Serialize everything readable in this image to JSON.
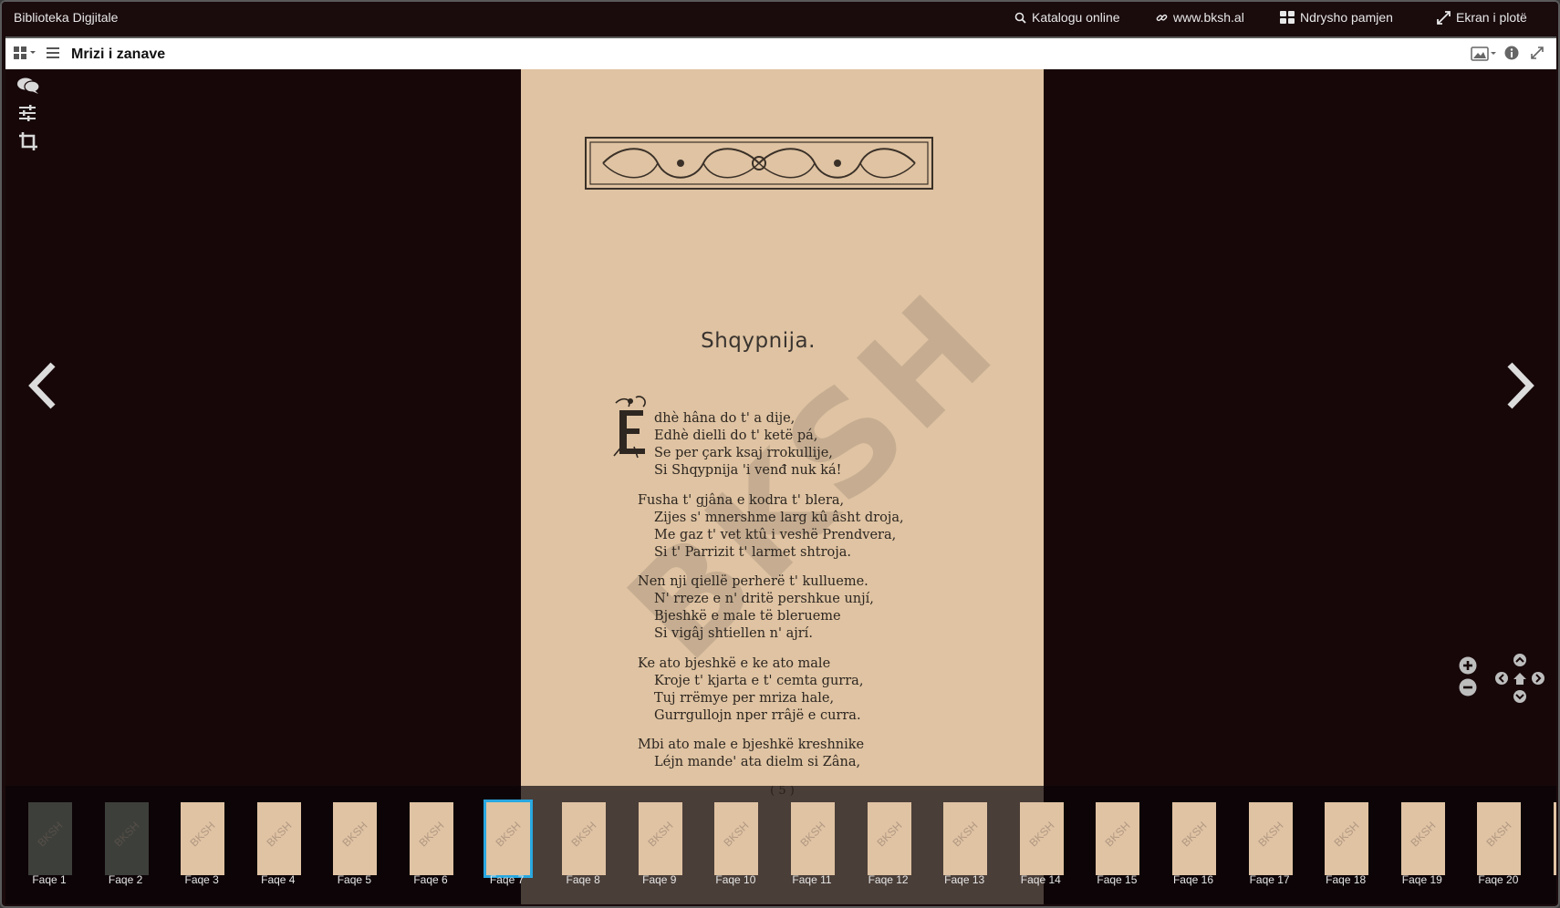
{
  "app": {
    "brand": "Biblioteka Digjitale",
    "nav": [
      {
        "icon": "search-icon",
        "label": "Katalogu online"
      },
      {
        "icon": "link-icon",
        "label": "www.bksh.al"
      },
      {
        "icon": "grid-icon",
        "label": "Ndrysho pamjen"
      },
      {
        "icon": "expand-icon",
        "label": "Ekran i plotë"
      }
    ]
  },
  "document": {
    "title": "Mrizi i zanave"
  },
  "page": {
    "heading": "Shqypnija.",
    "watermark": "BKSH",
    "stanzas": [
      [
        "dhè hâna do t' a dije,",
        "Edhè dielli do t' ketë pá,",
        "Se per çark ksaj rrokullije,",
        "Si Shqypnija 'i venđ nuk ká!"
      ],
      [
        "Fusha t' gjâna e kodra t' blera,",
        "Zijes s' mnershme larg kû âsht droja,",
        "Me gaz t' vet ktû i veshë Prendvera,",
        "Si t' Parrizit t' larmet shtroja."
      ],
      [
        "Nen nji qiellë perherë t' kullueme.",
        "N' rreze e n' dritë pershkue unjí,",
        "Bjeshkë e male të blerueme",
        "Si vigâj shtiellen n' ajrí."
      ],
      [
        "Ke ato bjeshkë e ke ato male",
        "Kroje t' kjarta e t' cemta gurra,",
        "Tuj rrëmye per mriza hale,",
        "Gurrgullojn nper rrâjë e curra."
      ],
      [
        "Mbi ato male e bjeshkë kreshnike",
        "Léjn mande' ata dielm si Zâna,"
      ]
    ],
    "page_number": "( 5 )"
  },
  "thumbnails": [
    {
      "label": "Faqe 1",
      "tone": "dark"
    },
    {
      "label": "Faqe 2",
      "tone": "dark"
    },
    {
      "label": "Faqe 3",
      "tone": "light"
    },
    {
      "label": "Faqe 4",
      "tone": "light"
    },
    {
      "label": "Faqe 5",
      "tone": "light"
    },
    {
      "label": "Faqe 6",
      "tone": "light"
    },
    {
      "label": "Faqe 7",
      "tone": "light",
      "selected": true
    },
    {
      "label": "Faqe 8",
      "tone": "light"
    },
    {
      "label": "Faqe 9",
      "tone": "light"
    },
    {
      "label": "Faqe 10",
      "tone": "light"
    },
    {
      "label": "Faqe 11",
      "tone": "light"
    },
    {
      "label": "Faqe 12",
      "tone": "light"
    },
    {
      "label": "Faqe 13",
      "tone": "light"
    },
    {
      "label": "Faqe 14",
      "tone": "light"
    },
    {
      "label": "Faqe 15",
      "tone": "light"
    },
    {
      "label": "Faqe 16",
      "tone": "light"
    },
    {
      "label": "Faqe 17",
      "tone": "light"
    },
    {
      "label": "Faqe 18",
      "tone": "light"
    },
    {
      "label": "Faqe 19",
      "tone": "light"
    },
    {
      "label": "Faqe 20",
      "tone": "light"
    },
    {
      "label": "Fa",
      "tone": "light"
    }
  ],
  "colors": {
    "background": "#170709",
    "page": "#dfc3a2",
    "selection": "#29a8e0"
  }
}
